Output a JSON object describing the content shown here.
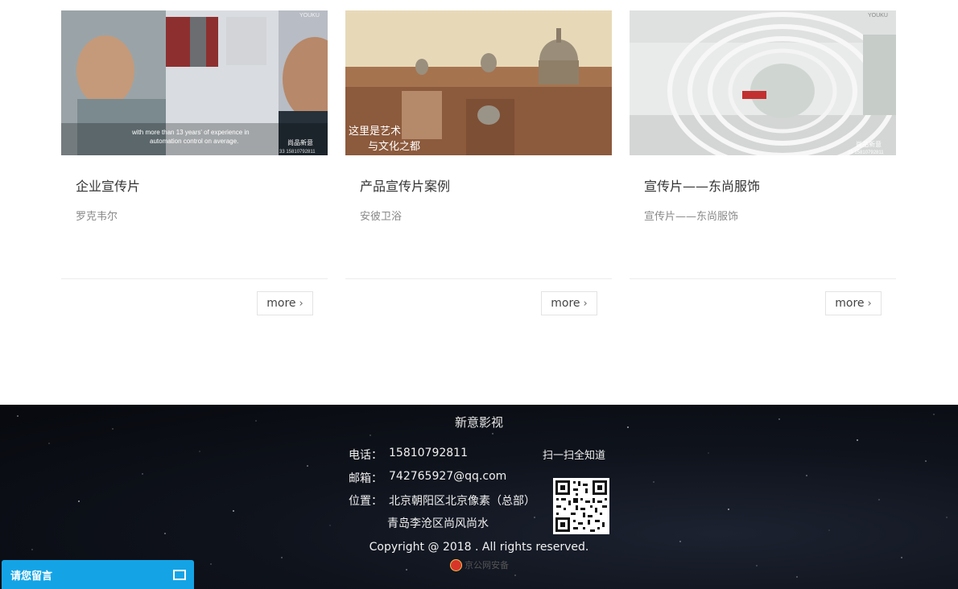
{
  "cards": [
    {
      "title": "企业宣传片",
      "subtitle": "罗克韦尔",
      "more_label": "more",
      "thumb": {
        "watermark": "YOUKU",
        "caption_line1": "with more than 13 years' of experience in",
        "caption_line2": "automation control on average.",
        "logo_text": "尚品新意",
        "phone_text": "33 15810792811"
      }
    },
    {
      "title": "产品宣传片案例",
      "subtitle": "安彼卫浴",
      "more_label": "more",
      "thumb": {
        "caption_line1": "这里是艺术",
        "caption_line2": "与文化之都"
      }
    },
    {
      "title": "宣传片——东尚服饰",
      "subtitle": "宣传片——东尚服饰",
      "more_label": "more",
      "thumb": {
        "watermark": "YOUKU",
        "logo_text": "尚品新意",
        "phone_text": "33 15810792811"
      }
    }
  ],
  "footer": {
    "brand": "新意影视",
    "phone_label": "电话：",
    "phone": "15810792811",
    "email_label": "邮箱：",
    "email": "742765927@qq.com",
    "address_label": "位置：",
    "address_line1": "北京朝阳区北京像素（总部）",
    "address_line2": "青岛李沧区尚风尚水",
    "qr_title": "扫一扫全知道",
    "copyright": "Copyright @ 2018 . All rights reserved.",
    "badge_text": "京公网安备"
  },
  "message_bar": {
    "label": "请您留言"
  },
  "colors": {
    "message_bar": "#14a4e6",
    "footer_bg": "#0b0e15"
  }
}
